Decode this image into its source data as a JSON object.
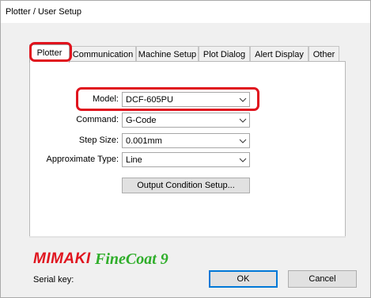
{
  "window": {
    "title": "Plotter / User Setup"
  },
  "tabs": [
    {
      "label": "Plotter",
      "active": true
    },
    {
      "label": "Communication"
    },
    {
      "label": "Machine Setup"
    },
    {
      "label": "Plot Dialog"
    },
    {
      "label": "Alert Display"
    },
    {
      "label": "Other"
    }
  ],
  "form": {
    "model": {
      "label": "Model:",
      "value": "DCF-605PU"
    },
    "command": {
      "label": "Command:",
      "value": "G-Code"
    },
    "step_size": {
      "label": "Step Size:",
      "value": "0.001mm"
    },
    "approximate_type": {
      "label": "Approximate Type:",
      "value": "Line"
    },
    "output_button": "Output Condition Setup..."
  },
  "branding": {
    "mimaki": "MIMAKI",
    "product": "FineCoat 9",
    "mimaki_color": "#e0141e",
    "product_color": "#2fae2a"
  },
  "footer": {
    "serial_label": "Serial key:",
    "ok": "OK",
    "cancel": "Cancel"
  },
  "highlight_color": "#e0141e"
}
